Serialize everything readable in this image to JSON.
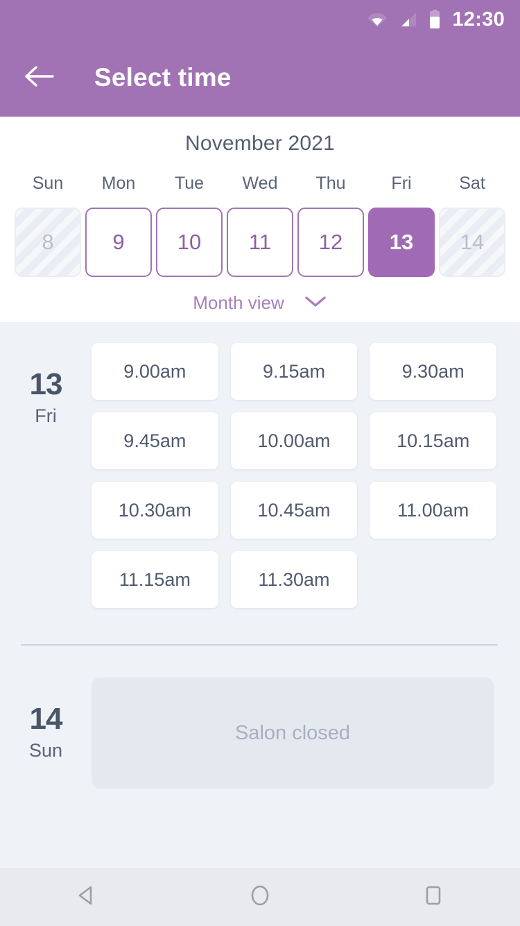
{
  "statusbar": {
    "time": "12:30",
    "icons": [
      "wifi-icon",
      "cell-signal-icon",
      "battery-icon"
    ]
  },
  "appbar": {
    "back_icon": "arrow-left-icon",
    "title": "Select time"
  },
  "calendar": {
    "month_title": "November 2021",
    "weekday_headers": [
      "Sun",
      "Mon",
      "Tue",
      "Wed",
      "Thu",
      "Fri",
      "Sat"
    ],
    "days": [
      {
        "num": "8",
        "state": "disabled"
      },
      {
        "num": "9",
        "state": "available"
      },
      {
        "num": "10",
        "state": "available"
      },
      {
        "num": "11",
        "state": "available"
      },
      {
        "num": "12",
        "state": "available"
      },
      {
        "num": "13",
        "state": "selected"
      },
      {
        "num": "14",
        "state": "disabled"
      }
    ],
    "view_toggle_label": "Month view",
    "view_toggle_icon": "chevron-down-icon",
    "colors": {
      "accent": "#a273b4",
      "selected_fill": "#a06ab4",
      "outline": "#a273b4",
      "available_text": "#8f5fa3",
      "disabled_text": "#b9c0cc"
    }
  },
  "days": [
    {
      "day_number": "13",
      "weekday": "Fri",
      "slots": [
        "9.00am",
        "9.15am",
        "9.30am",
        "9.45am",
        "10.00am",
        "10.15am",
        "10.30am",
        "10.45am",
        "11.00am",
        "11.15am",
        "11.30am"
      ]
    },
    {
      "day_number": "14",
      "weekday": "Sun",
      "closed_message": "Salon closed"
    }
  ],
  "navbar": {
    "back_icon": "triangle-back-icon",
    "home_icon": "circle-home-icon",
    "recents_icon": "square-recents-icon"
  }
}
